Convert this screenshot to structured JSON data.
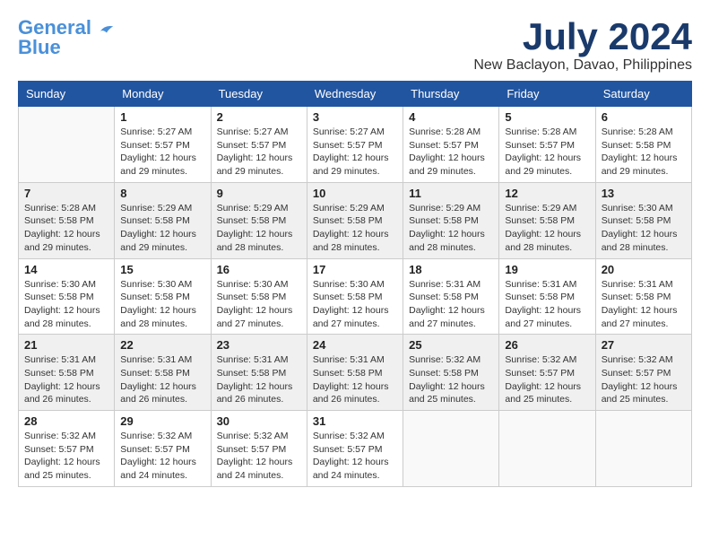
{
  "logo": {
    "text1": "General",
    "text2": "Blue"
  },
  "title": "July 2024",
  "location": "New Baclayon, Davao, Philippines",
  "days_of_week": [
    "Sunday",
    "Monday",
    "Tuesday",
    "Wednesday",
    "Thursday",
    "Friday",
    "Saturday"
  ],
  "weeks": [
    [
      {
        "day": "",
        "info": ""
      },
      {
        "day": "1",
        "info": "Sunrise: 5:27 AM\nSunset: 5:57 PM\nDaylight: 12 hours\nand 29 minutes."
      },
      {
        "day": "2",
        "info": "Sunrise: 5:27 AM\nSunset: 5:57 PM\nDaylight: 12 hours\nand 29 minutes."
      },
      {
        "day": "3",
        "info": "Sunrise: 5:27 AM\nSunset: 5:57 PM\nDaylight: 12 hours\nand 29 minutes."
      },
      {
        "day": "4",
        "info": "Sunrise: 5:28 AM\nSunset: 5:57 PM\nDaylight: 12 hours\nand 29 minutes."
      },
      {
        "day": "5",
        "info": "Sunrise: 5:28 AM\nSunset: 5:57 PM\nDaylight: 12 hours\nand 29 minutes."
      },
      {
        "day": "6",
        "info": "Sunrise: 5:28 AM\nSunset: 5:58 PM\nDaylight: 12 hours\nand 29 minutes."
      }
    ],
    [
      {
        "day": "7",
        "info": "Sunrise: 5:28 AM\nSunset: 5:58 PM\nDaylight: 12 hours\nand 29 minutes."
      },
      {
        "day": "8",
        "info": "Sunrise: 5:29 AM\nSunset: 5:58 PM\nDaylight: 12 hours\nand 29 minutes."
      },
      {
        "day": "9",
        "info": "Sunrise: 5:29 AM\nSunset: 5:58 PM\nDaylight: 12 hours\nand 28 minutes."
      },
      {
        "day": "10",
        "info": "Sunrise: 5:29 AM\nSunset: 5:58 PM\nDaylight: 12 hours\nand 28 minutes."
      },
      {
        "day": "11",
        "info": "Sunrise: 5:29 AM\nSunset: 5:58 PM\nDaylight: 12 hours\nand 28 minutes."
      },
      {
        "day": "12",
        "info": "Sunrise: 5:29 AM\nSunset: 5:58 PM\nDaylight: 12 hours\nand 28 minutes."
      },
      {
        "day": "13",
        "info": "Sunrise: 5:30 AM\nSunset: 5:58 PM\nDaylight: 12 hours\nand 28 minutes."
      }
    ],
    [
      {
        "day": "14",
        "info": "Sunrise: 5:30 AM\nSunset: 5:58 PM\nDaylight: 12 hours\nand 28 minutes."
      },
      {
        "day": "15",
        "info": "Sunrise: 5:30 AM\nSunset: 5:58 PM\nDaylight: 12 hours\nand 28 minutes."
      },
      {
        "day": "16",
        "info": "Sunrise: 5:30 AM\nSunset: 5:58 PM\nDaylight: 12 hours\nand 27 minutes."
      },
      {
        "day": "17",
        "info": "Sunrise: 5:30 AM\nSunset: 5:58 PM\nDaylight: 12 hours\nand 27 minutes."
      },
      {
        "day": "18",
        "info": "Sunrise: 5:31 AM\nSunset: 5:58 PM\nDaylight: 12 hours\nand 27 minutes."
      },
      {
        "day": "19",
        "info": "Sunrise: 5:31 AM\nSunset: 5:58 PM\nDaylight: 12 hours\nand 27 minutes."
      },
      {
        "day": "20",
        "info": "Sunrise: 5:31 AM\nSunset: 5:58 PM\nDaylight: 12 hours\nand 27 minutes."
      }
    ],
    [
      {
        "day": "21",
        "info": "Sunrise: 5:31 AM\nSunset: 5:58 PM\nDaylight: 12 hours\nand 26 minutes."
      },
      {
        "day": "22",
        "info": "Sunrise: 5:31 AM\nSunset: 5:58 PM\nDaylight: 12 hours\nand 26 minutes."
      },
      {
        "day": "23",
        "info": "Sunrise: 5:31 AM\nSunset: 5:58 PM\nDaylight: 12 hours\nand 26 minutes."
      },
      {
        "day": "24",
        "info": "Sunrise: 5:31 AM\nSunset: 5:58 PM\nDaylight: 12 hours\nand 26 minutes."
      },
      {
        "day": "25",
        "info": "Sunrise: 5:32 AM\nSunset: 5:58 PM\nDaylight: 12 hours\nand 25 minutes."
      },
      {
        "day": "26",
        "info": "Sunrise: 5:32 AM\nSunset: 5:57 PM\nDaylight: 12 hours\nand 25 minutes."
      },
      {
        "day": "27",
        "info": "Sunrise: 5:32 AM\nSunset: 5:57 PM\nDaylight: 12 hours\nand 25 minutes."
      }
    ],
    [
      {
        "day": "28",
        "info": "Sunrise: 5:32 AM\nSunset: 5:57 PM\nDaylight: 12 hours\nand 25 minutes."
      },
      {
        "day": "29",
        "info": "Sunrise: 5:32 AM\nSunset: 5:57 PM\nDaylight: 12 hours\nand 24 minutes."
      },
      {
        "day": "30",
        "info": "Sunrise: 5:32 AM\nSunset: 5:57 PM\nDaylight: 12 hours\nand 24 minutes."
      },
      {
        "day": "31",
        "info": "Sunrise: 5:32 AM\nSunset: 5:57 PM\nDaylight: 12 hours\nand 24 minutes."
      },
      {
        "day": "",
        "info": ""
      },
      {
        "day": "",
        "info": ""
      },
      {
        "day": "",
        "info": ""
      }
    ]
  ]
}
